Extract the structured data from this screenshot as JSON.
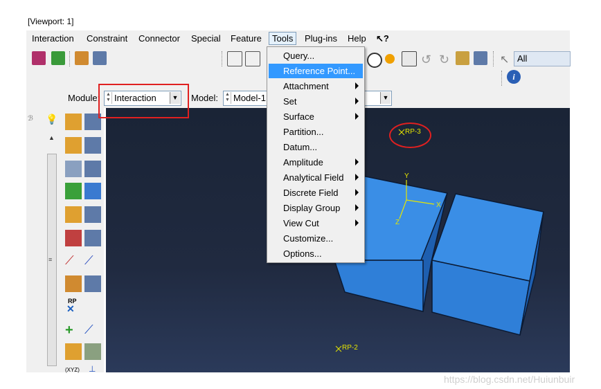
{
  "window": {
    "title": "[Viewport: 1]"
  },
  "menubar": {
    "items": [
      "Interaction",
      "Constraint",
      "Connector",
      "Special",
      "Feature",
      "Tools",
      "Plug-ins",
      "Help",
      "↖?"
    ]
  },
  "toolbar": {
    "selection_label": "All",
    "info_icon": "i"
  },
  "context": {
    "module_label": "Module:",
    "module_value": "Interaction",
    "model_label": "Model:",
    "model_value": "Model-1"
  },
  "tools_menu": {
    "items": [
      {
        "label": "Query...",
        "submenu": false,
        "highlighted": false
      },
      {
        "label": "Reference Point...",
        "submenu": false,
        "highlighted": true
      },
      {
        "label": "Attachment",
        "submenu": true,
        "highlighted": false
      },
      {
        "label": "Set",
        "submenu": true,
        "highlighted": false
      },
      {
        "label": "Surface",
        "submenu": true,
        "highlighted": false
      },
      {
        "label": "Partition...",
        "submenu": false,
        "highlighted": false
      },
      {
        "label": "Datum...",
        "submenu": false,
        "highlighted": false
      },
      {
        "label": "Amplitude",
        "submenu": true,
        "highlighted": false
      },
      {
        "label": "Analytical Field",
        "submenu": true,
        "highlighted": false
      },
      {
        "label": "Discrete Field",
        "submenu": true,
        "highlighted": false
      },
      {
        "label": "Display Group",
        "submenu": true,
        "highlighted": false
      },
      {
        "label": "View Cut",
        "submenu": true,
        "highlighted": false
      },
      {
        "label": "Customize...",
        "submenu": false,
        "highlighted": false
      },
      {
        "label": "Options...",
        "submenu": false,
        "highlighted": false
      }
    ]
  },
  "viewport": {
    "rp3_label": "RP-3",
    "rp2_label": "RP-2",
    "axis_y": "Y",
    "axis_x": "X",
    "axis_z": "Z"
  },
  "left_toolbox": {
    "rp_label": "RP",
    "xyz_label": "(XYZ)"
  },
  "colors": {
    "highlight": "#3399ff",
    "annotation_red": "#e02020",
    "part_blue": "#2f7fd8",
    "viewport_bg": "#1f2a40"
  },
  "watermark": "https://blog.csdn.net/Huiunbuir"
}
